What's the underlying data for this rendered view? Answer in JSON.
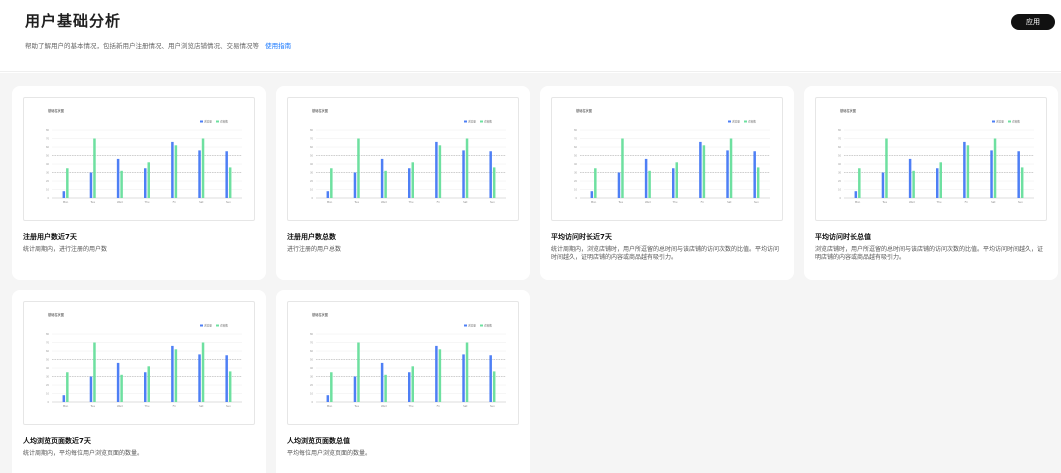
{
  "header": {
    "title": "用户基础分析",
    "description": "帮助了解用户的基本情况，包括新用户注册情况、用户浏览店铺情况、交易情况等",
    "help_link": "使用指南",
    "apply_button": "应用"
  },
  "chart_thumbnail": {
    "title": "基础柱状图",
    "legend": [
      "浏览量",
      "访客数"
    ],
    "colors": {
      "series1": "#4e7ff5",
      "series2": "#6ee0a0"
    }
  },
  "chart_data": {
    "type": "bar",
    "categories": [
      "Mon",
      "Tue",
      "Wed",
      "Thu",
      "Fri",
      "Sat",
      "Sun"
    ],
    "ylim": [
      0,
      80
    ],
    "series": [
      {
        "name": "浏览量",
        "values": [
          8,
          30,
          46,
          35,
          66,
          56,
          55
        ]
      },
      {
        "name": "访客数",
        "values": [
          35,
          70,
          32,
          42,
          62,
          70,
          36
        ]
      }
    ]
  },
  "cards": [
    {
      "title": "注册用户数近7天",
      "description": "统计周期内，进行注册的用户数"
    },
    {
      "title": "注册用户数总数",
      "description": "进行注册的用户总数"
    },
    {
      "title": "平均访问时长近7天",
      "description": "统计周期内，浏览店铺时，用户所逗留的总时间与该店铺的访问次数的比值。平均访问时间越久，证明店铺的内容或商品越有吸引力。"
    },
    {
      "title": "平均访问时长总值",
      "description": "浏览店铺时，用户所逗留的总时间与该店铺的访问次数的比值。平均访问时间越久，证明店铺的内容或商品越有吸引力。"
    },
    {
      "title": "人均浏览页面数近7天",
      "description": "统计周期内，平均每位用户浏览页面的数量。"
    },
    {
      "title": "人均浏览页面数总值",
      "description": "平均每位用户浏览页面的数量。"
    }
  ]
}
